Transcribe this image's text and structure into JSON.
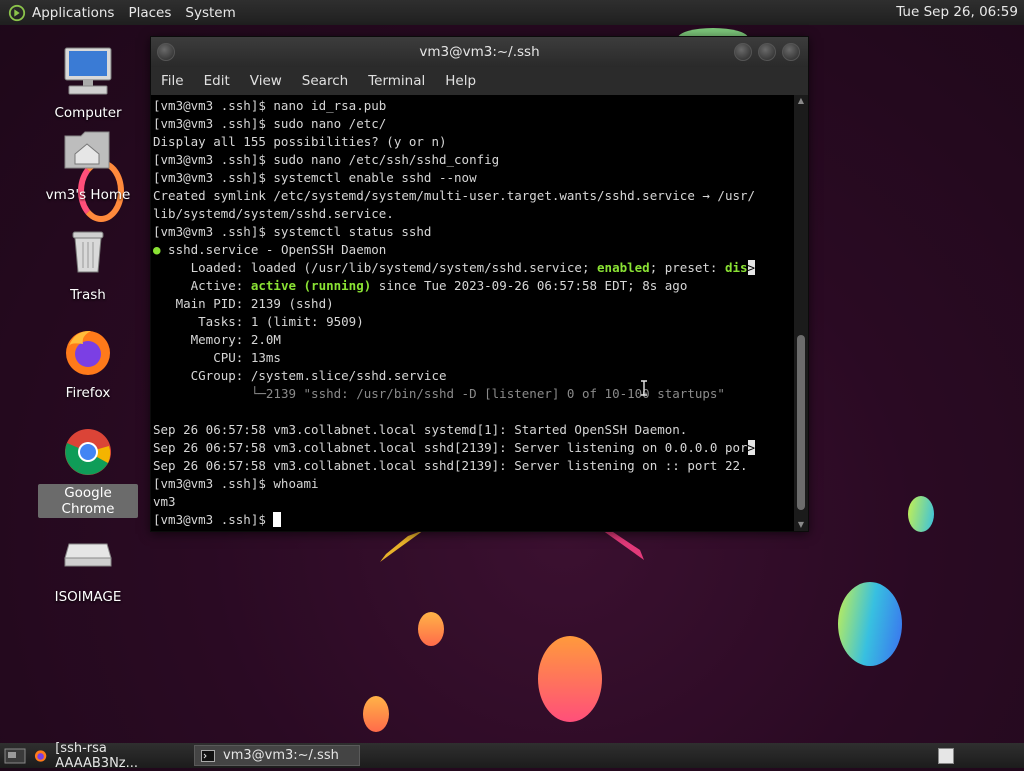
{
  "top_panel": {
    "menus": [
      "Applications",
      "Places",
      "System"
    ],
    "clock": "Tue Sep 26, 06:59"
  },
  "desktop": {
    "icons": [
      {
        "label": "Computer",
        "icon": "computer-icon"
      },
      {
        "label": "vm3's Home",
        "icon": "home-folder-icon"
      },
      {
        "label": "Trash",
        "icon": "trash-icon"
      },
      {
        "label": "Firefox",
        "icon": "firefox-icon"
      },
      {
        "label": "Google Chrome",
        "icon": "chrome-icon",
        "selected": true
      },
      {
        "label": "ISOIMAGE",
        "icon": "drive-icon"
      }
    ]
  },
  "terminal": {
    "title": "vm3@vm3:~/.ssh",
    "menu": [
      "File",
      "Edit",
      "View",
      "Search",
      "Terminal",
      "Help"
    ],
    "lines": {
      "l1": "[vm3@vm3 .ssh]$ nano id_rsa.pub",
      "l2": "[vm3@vm3 .ssh]$ sudo nano /etc/",
      "l3": "Display all 155 possibilities? (y or n)",
      "l4": "[vm3@vm3 .ssh]$ sudo nano /etc/ssh/sshd_config",
      "l5": "[vm3@vm3 .ssh]$ systemctl enable sshd --now",
      "l6": "Created symlink /etc/systemd/system/multi-user.target.wants/sshd.service → /usr/",
      "l7": "lib/systemd/system/sshd.service.",
      "l8": "[vm3@vm3 .ssh]$ systemctl status sshd",
      "l9_dot": "●",
      "l9": " sshd.service - OpenSSH Daemon",
      "l10_a": "     Loaded: loaded (/usr/lib/systemd/system/sshd.service; ",
      "l10_b": "enabled",
      "l10_c": "; preset: ",
      "l10_d": "dis",
      "l11_a": "     Active: ",
      "l11_b": "active (running)",
      "l11_c": " since Tue 2023-09-26 06:57:58 EDT; 8s ago",
      "l12": "   Main PID: 2139 (sshd)",
      "l13": "      Tasks: 1 (limit: 9509)",
      "l14": "     Memory: 2.0M",
      "l15": "        CPU: 13ms",
      "l16": "     CGroup: /system.slice/sshd.service",
      "l17_a": "             └─",
      "l17_b": "2139 \"sshd: /usr/bin/sshd -D [listener] 0 of 10-100 startups\"",
      "l18": "",
      "l19": "Sep 26 06:57:58 vm3.collabnet.local systemd[1]: Started OpenSSH Daemon.",
      "l20": "Sep 26 06:57:58 vm3.collabnet.local sshd[2139]: Server listening on 0.0.0.0 por",
      "l21": "Sep 26 06:57:58 vm3.collabnet.local sshd[2139]: Server listening on :: port 22.",
      "l22": "[vm3@vm3 .ssh]$ whoami",
      "l23": "vm3",
      "l24": "[vm3@vm3 .ssh]$ "
    },
    "truncation_marker": ">"
  },
  "taskbar": {
    "items": [
      {
        "label": "[ssh-rsa AAAAB3Nz...",
        "icon": "firefox-icon",
        "active": false
      },
      {
        "label": "vm3@vm3:~/.ssh",
        "icon": "terminal-icon",
        "active": true
      }
    ]
  }
}
